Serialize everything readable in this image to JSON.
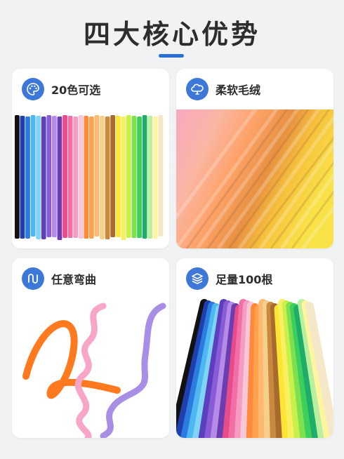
{
  "header": {
    "title": "四大核心优势"
  },
  "colors": {
    "accent": "#2a6fd6",
    "icon_bg": "#3d78d8",
    "background": "#f1f2f4"
  },
  "cards": [
    {
      "label": "20色可选",
      "icon": "palette-icon"
    },
    {
      "label": "柔软毛绒",
      "icon": "cotton-icon"
    },
    {
      "label": "任意弯曲",
      "icon": "bend-icon"
    },
    {
      "label": "足量100根",
      "icon": "layers-icon"
    }
  ],
  "stick_colors": [
    "#111111",
    "#1f3fae",
    "#2b7be0",
    "#4fb7f0",
    "#7fd4f5",
    "#5b3fbf",
    "#8a5bd6",
    "#b68be8",
    "#6b3db0",
    "#e84b8a",
    "#f36da6",
    "#f59cc3",
    "#f7c7d9",
    "#ff8a3d",
    "#ffa24d",
    "#ffb870",
    "#f4d08a",
    "#c98a3f",
    "#a86a2f",
    "#ffe533",
    "#f8f060",
    "#c8f04a",
    "#7fe04f",
    "#3dcf5e",
    "#1fae6a",
    "#b8f0a0",
    "#fff4a0",
    "#f5e8c8"
  ]
}
